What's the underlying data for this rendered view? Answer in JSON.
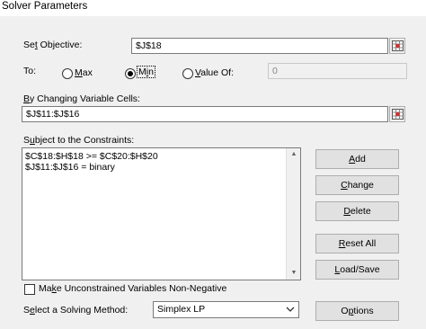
{
  "window": {
    "title": "Solver Parameters"
  },
  "objective": {
    "label_u": "t",
    "label_pre": "Se",
    "label_post": " Objective:",
    "value": "$J$18"
  },
  "to": {
    "label": "To:",
    "max_u": "M",
    "max_post": "ax",
    "min_u": "i",
    "min_pre": "M",
    "min_post": "n",
    "valueof_u": "V",
    "valueof_post": "alue Of:",
    "valueof_value": "0",
    "selected": "Min"
  },
  "changing": {
    "label_u": "B",
    "label_post": "y Changing Variable Cells:",
    "value": "$J$11:$J$16"
  },
  "constraints": {
    "label_u": "u",
    "label_pre": "S",
    "label_post": "bject to the Constraints:",
    "items": [
      "$C$18:$H$18 >= $C$20:$H$20",
      "$J$11:$J$16 = binary"
    ]
  },
  "buttons": {
    "add_u": "A",
    "add_post": "dd",
    "change_u": "C",
    "change_post": "hange",
    "delete_u": "D",
    "delete_post": "elete",
    "reset_u": "R",
    "reset_post": "eset All",
    "load_u": "L",
    "load_post": "oad/Save",
    "options_u": "p",
    "options_pre": "O",
    "options_post": "tions"
  },
  "nonneg": {
    "label_u": "k",
    "label_pre": "Ma",
    "label_post": "e Unconstrained Variables Non-Negative",
    "checked": false
  },
  "method": {
    "label_u": "e",
    "label_pre": "S",
    "label_post": "lect a Solving Method:",
    "value": "Simplex LP"
  },
  "icons": {
    "ref": "range-select-icon",
    "dropdown": "chevron-down-icon"
  }
}
